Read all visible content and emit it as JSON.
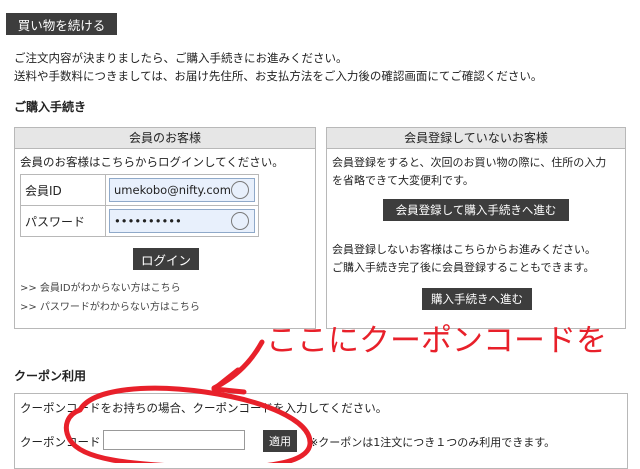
{
  "top": {
    "continue_button": "買い物を続ける",
    "line1": "ご注文内容が決まりましたら、ご購入手続きにお進みください。",
    "line2": "送料や手数料につきましては、お届け先住所、お支払方法をご入力後の確認画面にてご確認ください。"
  },
  "purchase": {
    "heading": "ご購入手続き",
    "member": {
      "title": "会員のお客様",
      "intro": "会員のお客様はこちらからログインしてください。",
      "id_label": "会員ID",
      "id_value": "umekobo@nifty.com",
      "password_label": "パスワード",
      "password_value": "••••••••••",
      "login_button": "ログイン",
      "forgot_id": ">> 会員IDがわからない方はこちら",
      "forgot_password": ">> パスワードがわからない方はこちら"
    },
    "guest": {
      "title": "会員登録していないお客様",
      "text1": "会員登録をすると、次回のお買い物の際に、住所の入力",
      "text2": "を省略できて大変便利です。",
      "register_button": "会員登録して購入手続きへ進む",
      "text3": "会員登録しないお客様はこちらからお進みください。",
      "text4": "ご購入手続き完了後に会員登録することもできます。",
      "proceed_button": "購入手続きへ進む"
    }
  },
  "annotation": {
    "text": "ここにクーポンコードを",
    "color": "#e8202a"
  },
  "coupon": {
    "heading": "クーポン利用",
    "instruction": "クーポンコードをお持ちの場合、クーポンコードを入力してください。",
    "label": "クーポンコード",
    "input_value": "",
    "apply_button": "適用",
    "note": "※クーポンは1注文につき１つのみ利用できます。"
  }
}
